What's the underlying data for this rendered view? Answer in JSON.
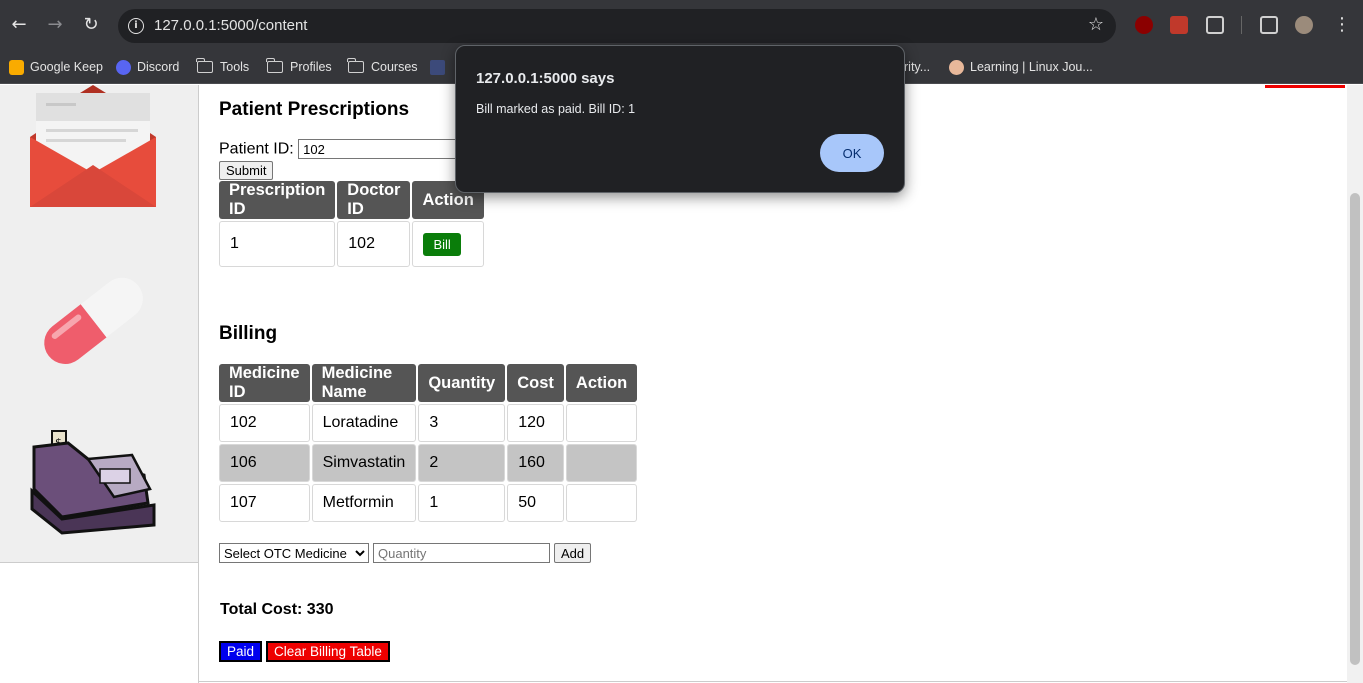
{
  "browser": {
    "url": "127.0.0.1:5000/content",
    "bookmarks": [
      {
        "label": "Google Keep",
        "icon": "google-keep-icon"
      },
      {
        "label": "Discord",
        "icon": "discord-icon"
      },
      {
        "label": "Tools",
        "icon": "folder-icon"
      },
      {
        "label": "Profiles",
        "icon": "folder-icon"
      },
      {
        "label": "Courses",
        "icon": "folder-icon"
      },
      {
        "label": "rity...",
        "icon": "bookmark-icon"
      },
      {
        "label": "Learning | Linux Jou...",
        "icon": "linux-journey-icon"
      }
    ]
  },
  "prescriptions": {
    "title": "Patient Prescriptions",
    "patient_id_label": "Patient ID:",
    "patient_id_value": "102",
    "submit_label": "Submit",
    "headers": [
      "Prescription ID",
      "Doctor ID",
      "Action"
    ],
    "rows": [
      {
        "prescription_id": "1",
        "doctor_id": "102",
        "action": "Bill"
      }
    ]
  },
  "billing": {
    "title": "Billing",
    "headers": [
      "Medicine ID",
      "Medicine Name",
      "Quantity",
      "Cost",
      "Action"
    ],
    "rows": [
      {
        "medicine_id": "102",
        "name": "Loratadine",
        "quantity": "3",
        "cost": "120",
        "action": ""
      },
      {
        "medicine_id": "106",
        "name": "Simvastatin",
        "quantity": "2",
        "cost": "160",
        "action": ""
      },
      {
        "medicine_id": "107",
        "name": "Metformin",
        "quantity": "1",
        "cost": "50",
        "action": ""
      }
    ],
    "otc_select": "Select OTC Medicine",
    "quantity_placeholder": "Quantity",
    "add_label": "Add",
    "total_cost": "Total Cost: 330",
    "paid_label": "Paid",
    "clear_label": "Clear Billing Table"
  },
  "dialog": {
    "title": "127.0.0.1:5000 says",
    "message": "Bill marked as paid. Bill ID: 1",
    "ok_label": "OK"
  },
  "colors": {
    "header_bg": "#555555",
    "bill_button": "#0a7d0a",
    "paid_button": "#0000ee",
    "clear_button": "#ee0000",
    "dialog_ok": "#a8c7fa"
  }
}
